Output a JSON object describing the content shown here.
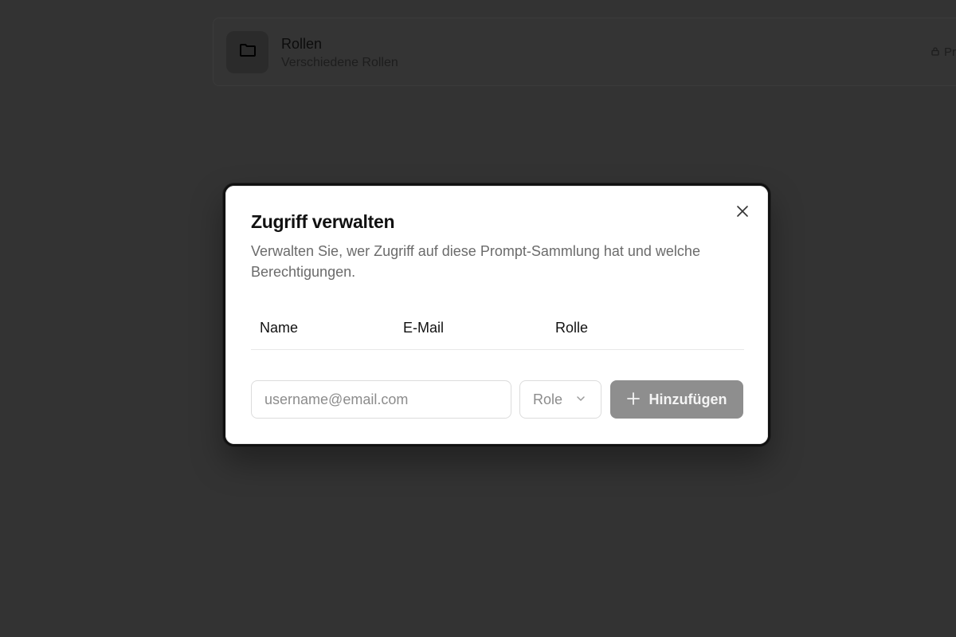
{
  "background_card": {
    "title": "Rollen",
    "subtitle": "Verschiedene Rollen",
    "lock_text": "Pr",
    "icons": {
      "folder": "folder-icon",
      "lock": "lock-icon"
    }
  },
  "modal": {
    "title": "Zugriff verwalten",
    "description": "Verwalten Sie, wer Zugriff auf diese Prompt-Sammlung hat und welche Berechtigungen.",
    "table": {
      "columns": [
        "Name",
        "E-Mail",
        "Rolle"
      ],
      "rows": []
    },
    "add_row": {
      "email_placeholder": "username@email.com",
      "role_placeholder": "Role",
      "add_button_label": "Hinzufügen"
    },
    "icons": {
      "close": "close-icon",
      "plus": "plus-icon",
      "chevron": "chevron-down-icon"
    }
  },
  "colors": {
    "overlay_bg": "#333333",
    "modal_bg": "#ffffff",
    "button_disabled": "#8e8e8e",
    "muted_text": "#6b6b6b"
  }
}
